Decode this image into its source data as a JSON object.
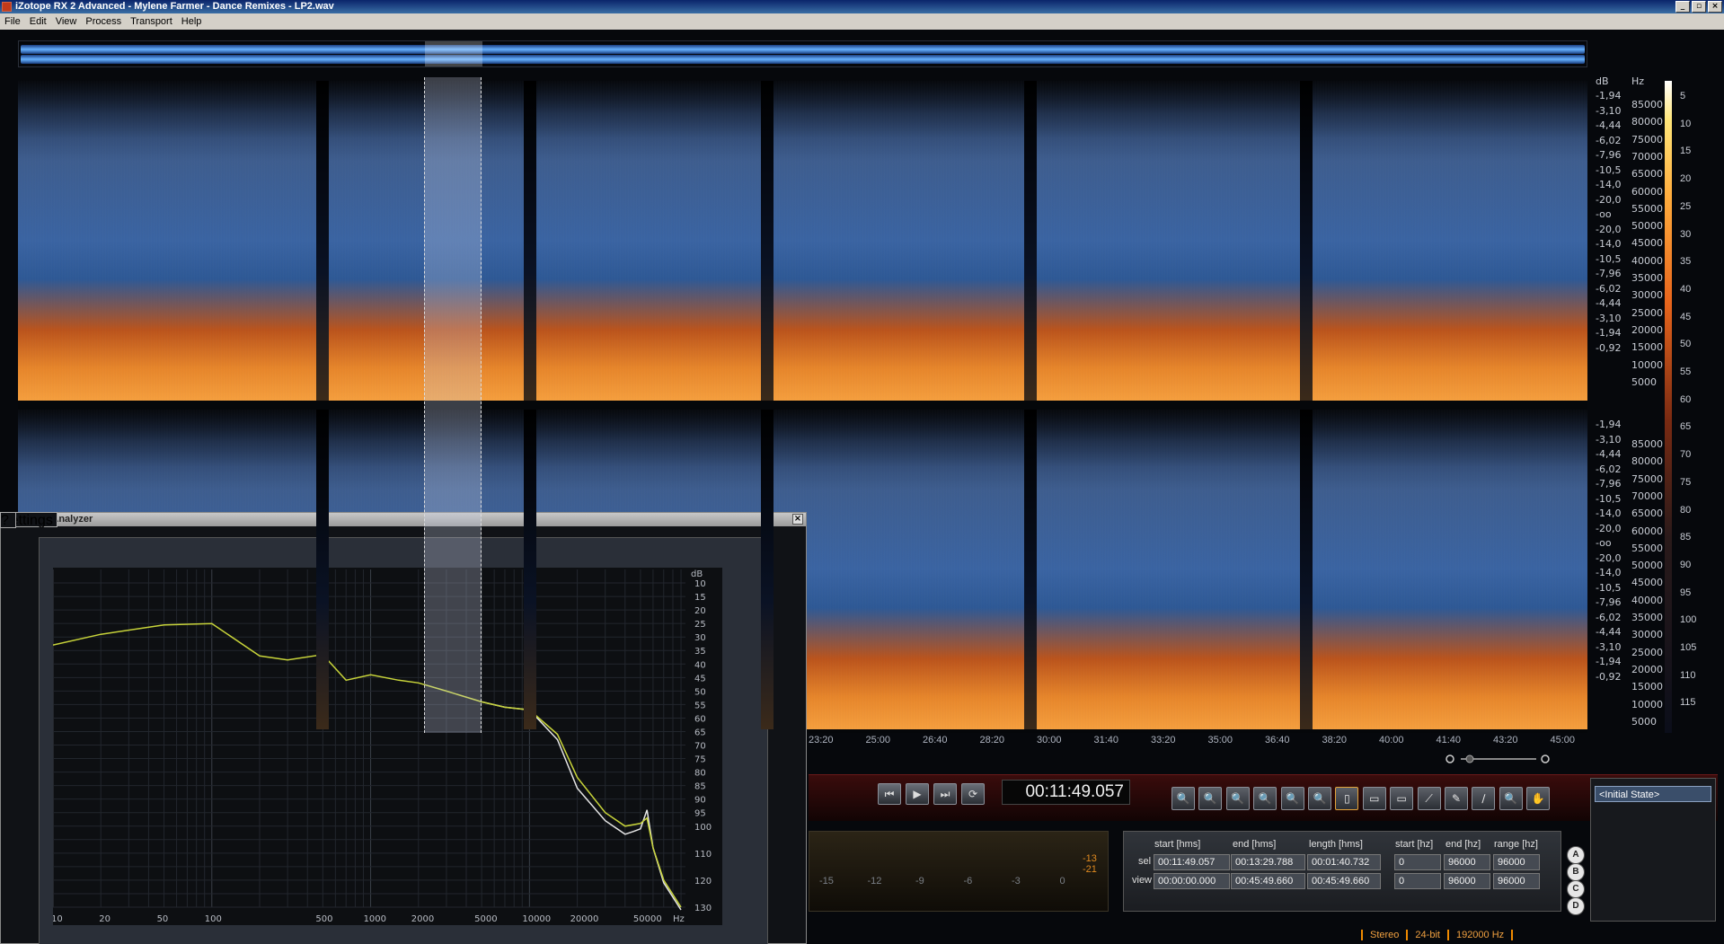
{
  "window": {
    "title": "iZotope RX 2 Advanced - Mylene Farmer - Dance Remixes - LP2.wav",
    "buttons": [
      "_",
      "▫",
      "×"
    ]
  },
  "menu": [
    "File",
    "Edit",
    "View",
    "Process",
    "Transport",
    "Help"
  ],
  "scale": {
    "db_header": "dB",
    "hz_header": "Hz",
    "top_db": [
      "-1,94",
      "-3,10",
      "-4,44",
      "-6,02",
      "-7,96",
      "-10,5",
      "-14,0",
      "-20,0",
      "-oo",
      "-20,0",
      "-14,0",
      "-10,5",
      "-7,96",
      "-6,02",
      "-4,44",
      "-3,10",
      "-1,94",
      "-0,92"
    ],
    "top_hz": [
      "85000",
      "80000",
      "75000",
      "70000",
      "65000",
      "60000",
      "55000",
      "50000",
      "45000",
      "40000",
      "35000",
      "30000",
      "25000",
      "20000",
      "15000",
      "10000",
      "5000"
    ],
    "bottom_db": [
      "-1,94",
      "-3,10",
      "-4,44",
      "-6,02",
      "-7,96",
      "-10,5",
      "-14,0",
      "-20,0",
      "-oo",
      "-20,0",
      "-14,0",
      "-10,5",
      "-7,96",
      "-6,02",
      "-4,44",
      "-3,10",
      "-1,94",
      "-0,92"
    ],
    "bottom_hz": [
      "85000",
      "80000",
      "75000",
      "70000",
      "65000",
      "60000",
      "55000",
      "50000",
      "45000",
      "40000",
      "35000",
      "30000",
      "25000",
      "20000",
      "15000",
      "10000",
      "5000"
    ],
    "colorbar": [
      "5",
      "10",
      "15",
      "20",
      "25",
      "30",
      "35",
      "40",
      "45",
      "50",
      "55",
      "60",
      "65",
      "70",
      "75",
      "80",
      "85",
      "90",
      "95",
      "100",
      "105",
      "110",
      "115"
    ]
  },
  "timeline": [
    "23:20",
    "25:00",
    "26:40",
    "28:20",
    "30:00",
    "31:40",
    "33:20",
    "35:00",
    "36:40",
    "38:20",
    "40:00",
    "41:40",
    "43:20",
    "45:00"
  ],
  "transport": {
    "timecode": "00:11:49.057",
    "buttons": [
      "⏮",
      "▶",
      "⏭",
      "⟳"
    ],
    "tools": [
      "🔍",
      "🔍",
      "🔍",
      "🔍",
      "🔍",
      "🔍",
      "▯",
      "▭",
      "▭",
      "⟋",
      "✎",
      "∕",
      "🔍",
      "✋"
    ]
  },
  "meter": {
    "labels": [
      "-15",
      "-12",
      "-9",
      "-6",
      "-3",
      "0"
    ],
    "peaks": [
      "-13",
      "-21"
    ]
  },
  "selection": {
    "headers": [
      "start [hms]",
      "end [hms]",
      "length [hms]",
      "start [hz]",
      "end [hz]",
      "range [hz]"
    ],
    "rows": [
      {
        "label": "sel",
        "values": [
          "00:11:49.057",
          "00:13:29.788",
          "00:01:40.732",
          "0",
          "96000",
          "96000"
        ]
      },
      {
        "label": "view",
        "values": [
          "00:00:00.000",
          "00:45:49.660",
          "00:45:49.660",
          "0",
          "96000",
          "96000"
        ]
      }
    ]
  },
  "abcd": [
    "A",
    "B",
    "C",
    "D"
  ],
  "history": {
    "item": "<Initial State>"
  },
  "status": [
    "Stereo",
    "24-bit",
    "192000 Hz"
  ],
  "spectrum_analyzer": {
    "title": "Spectrum Analyzer",
    "close": "×",
    "settings": "Settings",
    "help": "?",
    "db_header": "dB",
    "db_ticks": [
      "10",
      "15",
      "20",
      "25",
      "30",
      "35",
      "40",
      "45",
      "50",
      "55",
      "60",
      "65",
      "70",
      "75",
      "80",
      "85",
      "90",
      "95",
      "100",
      "110",
      "120",
      "130"
    ],
    "hz_ticks": [
      "10",
      "20",
      "50",
      "100",
      "500",
      "1000",
      "2000",
      "5000",
      "10000",
      "20000",
      "50000",
      "Hz"
    ]
  },
  "chart_data": {
    "type": "line",
    "xlabel": "Hz",
    "ylabel": "dB",
    "x_scale": "log",
    "xlim": [
      10,
      96000
    ],
    "ylim": [
      -130,
      -5
    ],
    "series": [
      {
        "color": "#c8d43a",
        "x": [
          10,
          20,
          50,
          100,
          200,
          300,
          500,
          700,
          1000,
          1500,
          2000,
          3000,
          5000,
          7000,
          10000,
          15000,
          20000,
          30000,
          40000,
          50000,
          55000,
          60000,
          70000,
          90000
        ],
        "y": [
          -33,
          -29,
          -25.5,
          -25,
          -37,
          -38.5,
          -36.5,
          -46,
          -44,
          -46,
          -47,
          -50,
          -54,
          -56,
          -57,
          -66,
          -82,
          -95,
          -100,
          -99,
          -97,
          -108,
          -120,
          -130
        ]
      },
      {
        "color": "#e6e6e6",
        "x": [
          5000,
          7000,
          10000,
          15000,
          20000,
          30000,
          40000,
          45000,
          50000,
          55000,
          60000,
          70000,
          90000
        ],
        "y": [
          -54,
          -56,
          -57,
          -68,
          -86,
          -98,
          -103,
          -102,
          -101,
          -94,
          -108,
          -121,
          -131
        ]
      }
    ]
  }
}
